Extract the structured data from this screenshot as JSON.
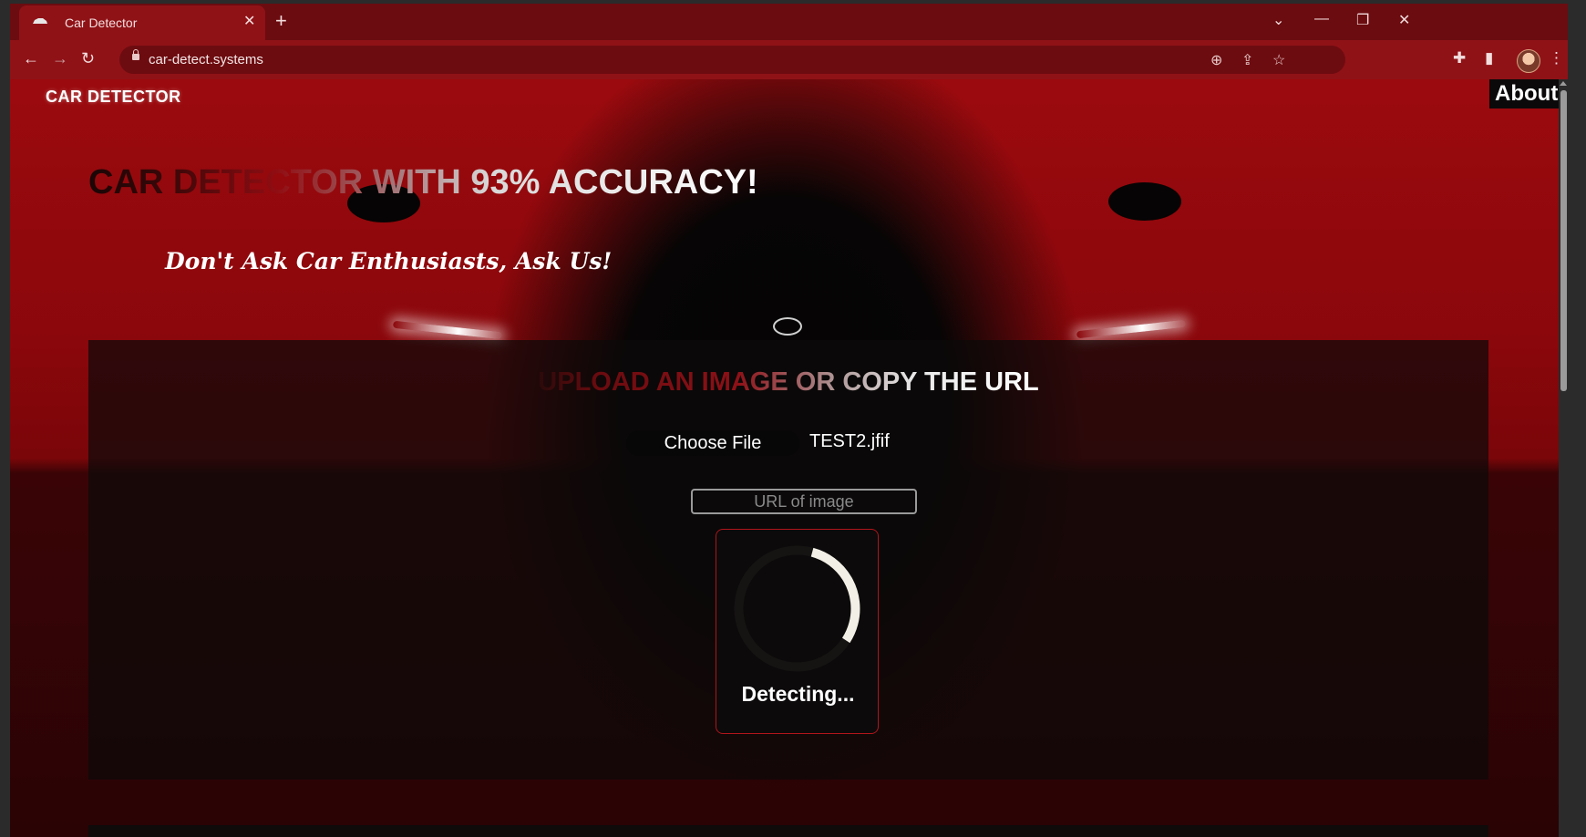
{
  "browser": {
    "tab_title": "Car Detector",
    "url": "car-detect.systems"
  },
  "icons": {
    "back": "back-arrow-icon",
    "forward": "forward-arrow-icon",
    "reload": "reload-icon",
    "zoom": "zoom-icon",
    "share": "share-icon",
    "bookmark": "star-icon",
    "extensions": "puzzle-icon",
    "sidepanel": "side-panel-icon",
    "menu": "kebab-menu-icon"
  },
  "site": {
    "logo": "CAR DETECTOR",
    "nav_about": "About",
    "headline": "CAR DETECTOR WITH 93% ACCURACY!",
    "tagline": "Don't Ask Car Enthusiasts, Ask Us!"
  },
  "upload": {
    "title": "UPLOAD AN IMAGE OR COPY THE URL",
    "choose_file_label": "Choose File",
    "file_name": "TEST2.jfif",
    "url_placeholder": "URL of image"
  },
  "detection": {
    "status": "Detecting...",
    "progress_fraction": 0.3
  },
  "colors": {
    "brand_red": "#8f1217",
    "card_border": "#b0151b"
  }
}
